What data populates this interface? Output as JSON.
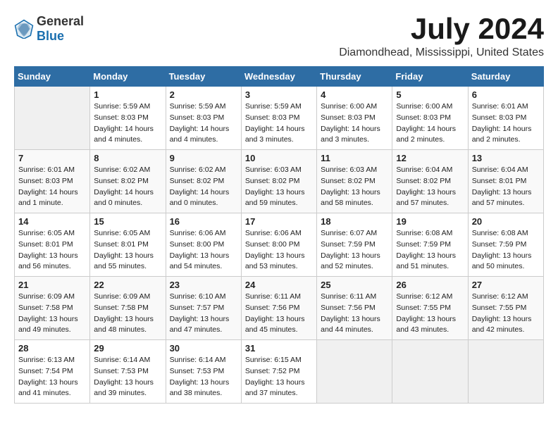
{
  "logo": {
    "general": "General",
    "blue": "Blue"
  },
  "header": {
    "month": "July 2024",
    "location": "Diamondhead, Mississippi, United States"
  },
  "weekdays": [
    "Sunday",
    "Monday",
    "Tuesday",
    "Wednesday",
    "Thursday",
    "Friday",
    "Saturday"
  ],
  "weeks": [
    [
      {
        "day": "",
        "info": ""
      },
      {
        "day": "1",
        "info": "Sunrise: 5:59 AM\nSunset: 8:03 PM\nDaylight: 14 hours\nand 4 minutes."
      },
      {
        "day": "2",
        "info": "Sunrise: 5:59 AM\nSunset: 8:03 PM\nDaylight: 14 hours\nand 4 minutes."
      },
      {
        "day": "3",
        "info": "Sunrise: 5:59 AM\nSunset: 8:03 PM\nDaylight: 14 hours\nand 3 minutes."
      },
      {
        "day": "4",
        "info": "Sunrise: 6:00 AM\nSunset: 8:03 PM\nDaylight: 14 hours\nand 3 minutes."
      },
      {
        "day": "5",
        "info": "Sunrise: 6:00 AM\nSunset: 8:03 PM\nDaylight: 14 hours\nand 2 minutes."
      },
      {
        "day": "6",
        "info": "Sunrise: 6:01 AM\nSunset: 8:03 PM\nDaylight: 14 hours\nand 2 minutes."
      }
    ],
    [
      {
        "day": "7",
        "info": "Sunrise: 6:01 AM\nSunset: 8:03 PM\nDaylight: 14 hours\nand 1 minute."
      },
      {
        "day": "8",
        "info": "Sunrise: 6:02 AM\nSunset: 8:02 PM\nDaylight: 14 hours\nand 0 minutes."
      },
      {
        "day": "9",
        "info": "Sunrise: 6:02 AM\nSunset: 8:02 PM\nDaylight: 14 hours\nand 0 minutes."
      },
      {
        "day": "10",
        "info": "Sunrise: 6:03 AM\nSunset: 8:02 PM\nDaylight: 13 hours\nand 59 minutes."
      },
      {
        "day": "11",
        "info": "Sunrise: 6:03 AM\nSunset: 8:02 PM\nDaylight: 13 hours\nand 58 minutes."
      },
      {
        "day": "12",
        "info": "Sunrise: 6:04 AM\nSunset: 8:02 PM\nDaylight: 13 hours\nand 57 minutes."
      },
      {
        "day": "13",
        "info": "Sunrise: 6:04 AM\nSunset: 8:01 PM\nDaylight: 13 hours\nand 57 minutes."
      }
    ],
    [
      {
        "day": "14",
        "info": "Sunrise: 6:05 AM\nSunset: 8:01 PM\nDaylight: 13 hours\nand 56 minutes."
      },
      {
        "day": "15",
        "info": "Sunrise: 6:05 AM\nSunset: 8:01 PM\nDaylight: 13 hours\nand 55 minutes."
      },
      {
        "day": "16",
        "info": "Sunrise: 6:06 AM\nSunset: 8:00 PM\nDaylight: 13 hours\nand 54 minutes."
      },
      {
        "day": "17",
        "info": "Sunrise: 6:06 AM\nSunset: 8:00 PM\nDaylight: 13 hours\nand 53 minutes."
      },
      {
        "day": "18",
        "info": "Sunrise: 6:07 AM\nSunset: 7:59 PM\nDaylight: 13 hours\nand 52 minutes."
      },
      {
        "day": "19",
        "info": "Sunrise: 6:08 AM\nSunset: 7:59 PM\nDaylight: 13 hours\nand 51 minutes."
      },
      {
        "day": "20",
        "info": "Sunrise: 6:08 AM\nSunset: 7:59 PM\nDaylight: 13 hours\nand 50 minutes."
      }
    ],
    [
      {
        "day": "21",
        "info": "Sunrise: 6:09 AM\nSunset: 7:58 PM\nDaylight: 13 hours\nand 49 minutes."
      },
      {
        "day": "22",
        "info": "Sunrise: 6:09 AM\nSunset: 7:58 PM\nDaylight: 13 hours\nand 48 minutes."
      },
      {
        "day": "23",
        "info": "Sunrise: 6:10 AM\nSunset: 7:57 PM\nDaylight: 13 hours\nand 47 minutes."
      },
      {
        "day": "24",
        "info": "Sunrise: 6:11 AM\nSunset: 7:56 PM\nDaylight: 13 hours\nand 45 minutes."
      },
      {
        "day": "25",
        "info": "Sunrise: 6:11 AM\nSunset: 7:56 PM\nDaylight: 13 hours\nand 44 minutes."
      },
      {
        "day": "26",
        "info": "Sunrise: 6:12 AM\nSunset: 7:55 PM\nDaylight: 13 hours\nand 43 minutes."
      },
      {
        "day": "27",
        "info": "Sunrise: 6:12 AM\nSunset: 7:55 PM\nDaylight: 13 hours\nand 42 minutes."
      }
    ],
    [
      {
        "day": "28",
        "info": "Sunrise: 6:13 AM\nSunset: 7:54 PM\nDaylight: 13 hours\nand 41 minutes."
      },
      {
        "day": "29",
        "info": "Sunrise: 6:14 AM\nSunset: 7:53 PM\nDaylight: 13 hours\nand 39 minutes."
      },
      {
        "day": "30",
        "info": "Sunrise: 6:14 AM\nSunset: 7:53 PM\nDaylight: 13 hours\nand 38 minutes."
      },
      {
        "day": "31",
        "info": "Sunrise: 6:15 AM\nSunset: 7:52 PM\nDaylight: 13 hours\nand 37 minutes."
      },
      {
        "day": "",
        "info": ""
      },
      {
        "day": "",
        "info": ""
      },
      {
        "day": "",
        "info": ""
      }
    ]
  ]
}
